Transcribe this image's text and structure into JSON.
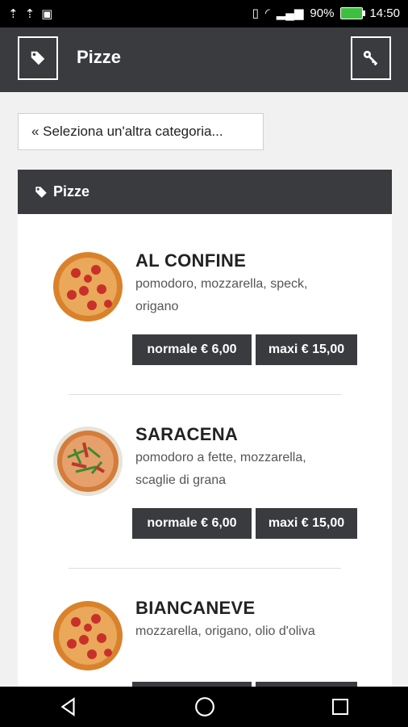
{
  "status": {
    "battery": "90%",
    "time": "14:50"
  },
  "appbar": {
    "title": "Pizze",
    "left_icon": "tag-icon",
    "right_icon": "key-icon"
  },
  "category_button": {
    "label": "« Seleziona un'altra categoria..."
  },
  "card": {
    "header_icon": "tag-icon",
    "header": "Pizze",
    "items": [
      {
        "name": "AL CONFINE",
        "desc": "pomodoro, mozzarella, speck, origano",
        "price_normal": "normale € 6,00",
        "price_maxi": "maxi € 15,00"
      },
      {
        "name": "SARACENA",
        "desc": "pomodoro a fette, mozzarella, scaglie di grana",
        "price_normal": "normale € 6,00",
        "price_maxi": "maxi € 15,00"
      },
      {
        "name": "BIANCANEVE",
        "desc": "mozzarella, origano, olio d'oliva",
        "price_normal": "",
        "price_maxi": ""
      }
    ]
  },
  "colors": {
    "dark": "#3a3b3f",
    "bg": "#f1f1f1"
  }
}
